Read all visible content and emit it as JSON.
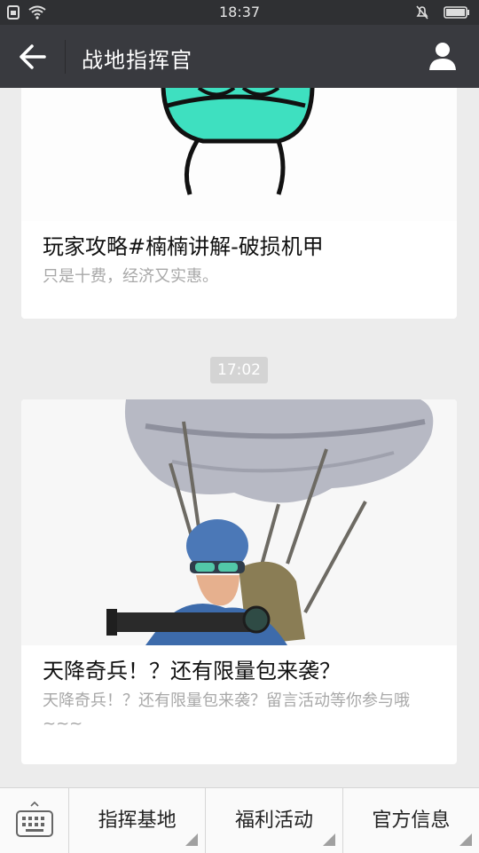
{
  "status_bar": {
    "time": "18:37"
  },
  "header": {
    "title": "战地指挥官"
  },
  "feed": {
    "cards": [
      {
        "title": "玩家攻略#楠楠讲解-破损机甲",
        "desc": "只是十费，经济又实惠。"
      },
      {
        "title": "天降奇兵！？还有限量包来袭？",
        "desc": "天降奇兵！？还有限量包来袭？留言活动等你参与哦~~~"
      }
    ],
    "time_divider": "17:02"
  },
  "bottom_menu": {
    "items": [
      {
        "label": "指挥基地"
      },
      {
        "label": "福利活动"
      },
      {
        "label": "官方信息"
      }
    ]
  }
}
